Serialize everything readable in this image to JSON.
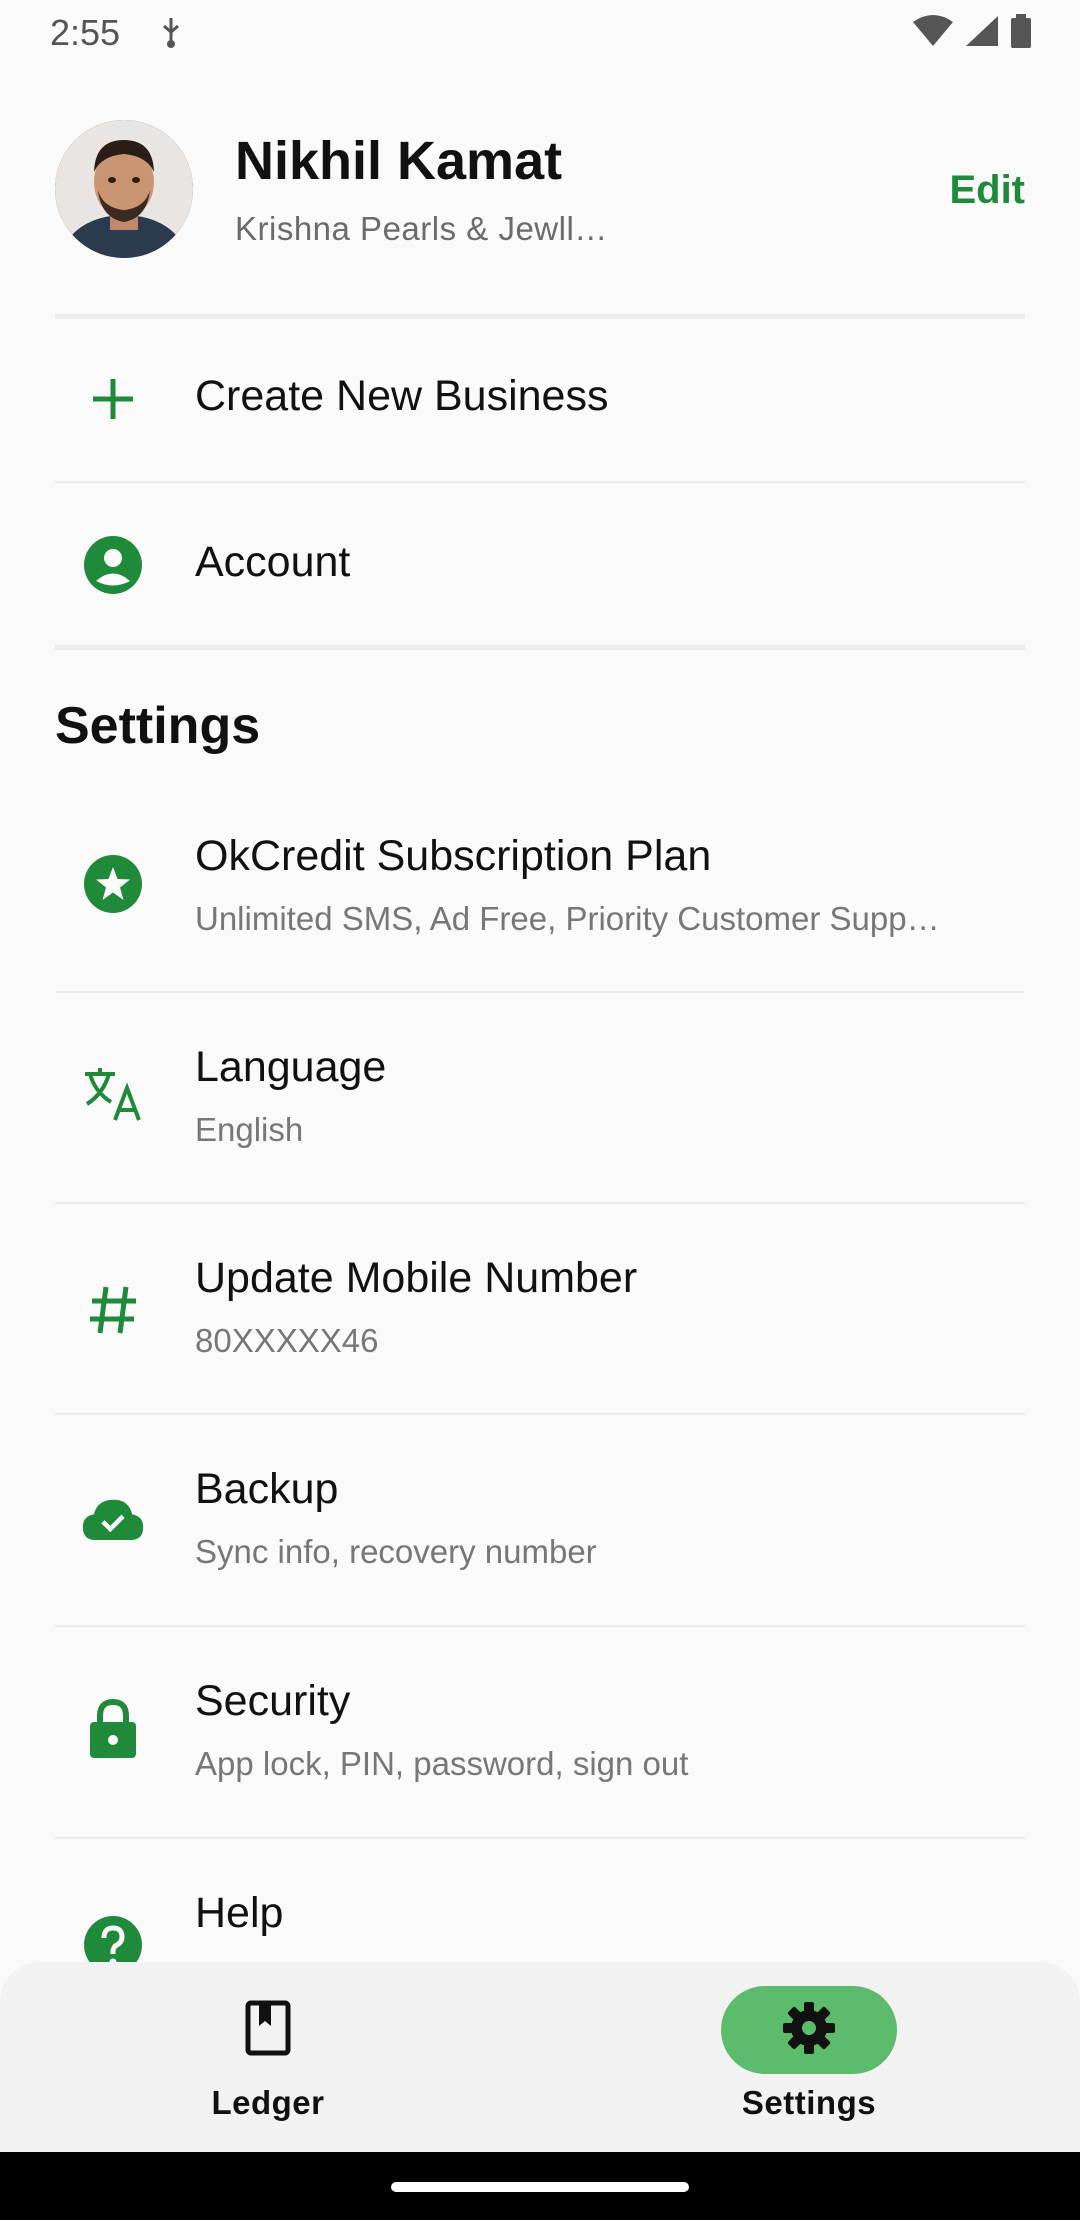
{
  "status_bar": {
    "time": "2:55",
    "icons": [
      "usb-icon",
      "wifi-icon",
      "signal-icon",
      "battery-icon"
    ]
  },
  "profile": {
    "name": "Nikhil Kamat",
    "business": "Krishna Pearls & Jewll…",
    "edit_label": "Edit"
  },
  "actions": [
    {
      "label": "Create New Business",
      "icon": "plus-icon"
    },
    {
      "label": "Account",
      "icon": "account-circle-icon"
    }
  ],
  "settings": {
    "heading": "Settings",
    "items": [
      {
        "title": "OkCredit Subscription Plan",
        "subtitle": "Unlimited SMS, Ad Free, Priority Customer Supp…",
        "icon": "star-badge-icon"
      },
      {
        "title": "Language",
        "subtitle": "English",
        "icon": "translate-icon"
      },
      {
        "title": "Update Mobile Number",
        "subtitle": "80XXXXX46",
        "icon": "hash-icon"
      },
      {
        "title": "Backup",
        "subtitle": "Sync info, recovery number",
        "icon": "cloud-check-icon"
      },
      {
        "title": "Security",
        "subtitle": "App lock, PIN, password, sign out",
        "icon": "lock-icon"
      },
      {
        "title": "Help",
        "subtitle": "",
        "icon": "help-icon"
      }
    ]
  },
  "bottom_nav": {
    "items": [
      {
        "label": "Ledger",
        "icon": "ledger-book-icon",
        "active": false
      },
      {
        "label": "Settings",
        "icon": "settings-gear-icon",
        "active": true
      }
    ]
  },
  "colors": {
    "accent": "#1f8a3a",
    "active_pill": "#5cbc6c",
    "background": "#fafafa"
  }
}
